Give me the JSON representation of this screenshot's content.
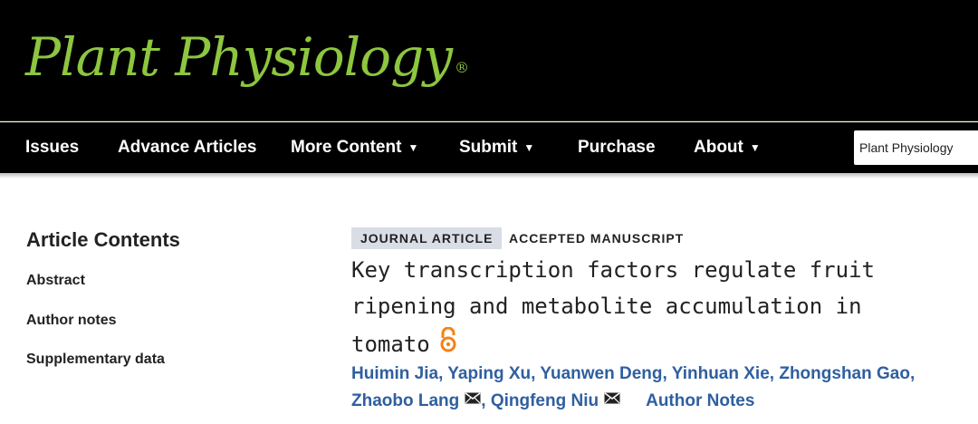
{
  "journal": {
    "logo_text": "Plant Physiology",
    "registered_mark": "®",
    "logo_color": "#8dc63f",
    "background": "#000000"
  },
  "nav": {
    "items": [
      {
        "label": "Issues",
        "has_dropdown": false
      },
      {
        "label": "Advance Articles",
        "has_dropdown": false
      },
      {
        "label": "More Content",
        "has_dropdown": true
      },
      {
        "label": "Submit",
        "has_dropdown": true
      },
      {
        "label": "Purchase",
        "has_dropdown": false
      },
      {
        "label": "About",
        "has_dropdown": true
      }
    ],
    "caret": "▼",
    "search_scope": "Plant Physiology"
  },
  "sidebar": {
    "title": "Article Contents",
    "links": [
      "Abstract",
      "Author notes",
      "Supplementary data"
    ]
  },
  "article": {
    "type_badge": "JOURNAL ARTICLE",
    "status_badge": "ACCEPTED MANUSCRIPT",
    "title_lines": [
      "Key transcription factors regulate fruit",
      "ripening and metabolite accumulation in",
      "tomato"
    ],
    "open_access_icon": "open-access-icon",
    "open_access_color": "#f68212",
    "link_color": "#2f5f9f",
    "authors": [
      {
        "name": "Huimin Jia",
        "corresponding": false
      },
      {
        "name": "Yaping Xu",
        "corresponding": false
      },
      {
        "name": "Yuanwen Deng",
        "corresponding": false
      },
      {
        "name": "Yinhuan Xie",
        "corresponding": false
      },
      {
        "name": "Zhongshan Gao",
        "corresponding": false
      },
      {
        "name": "Zhaobo Lang",
        "corresponding": true
      },
      {
        "name": "Qingfeng Niu",
        "corresponding": true
      }
    ],
    "author_notes_label": "Author Notes"
  }
}
